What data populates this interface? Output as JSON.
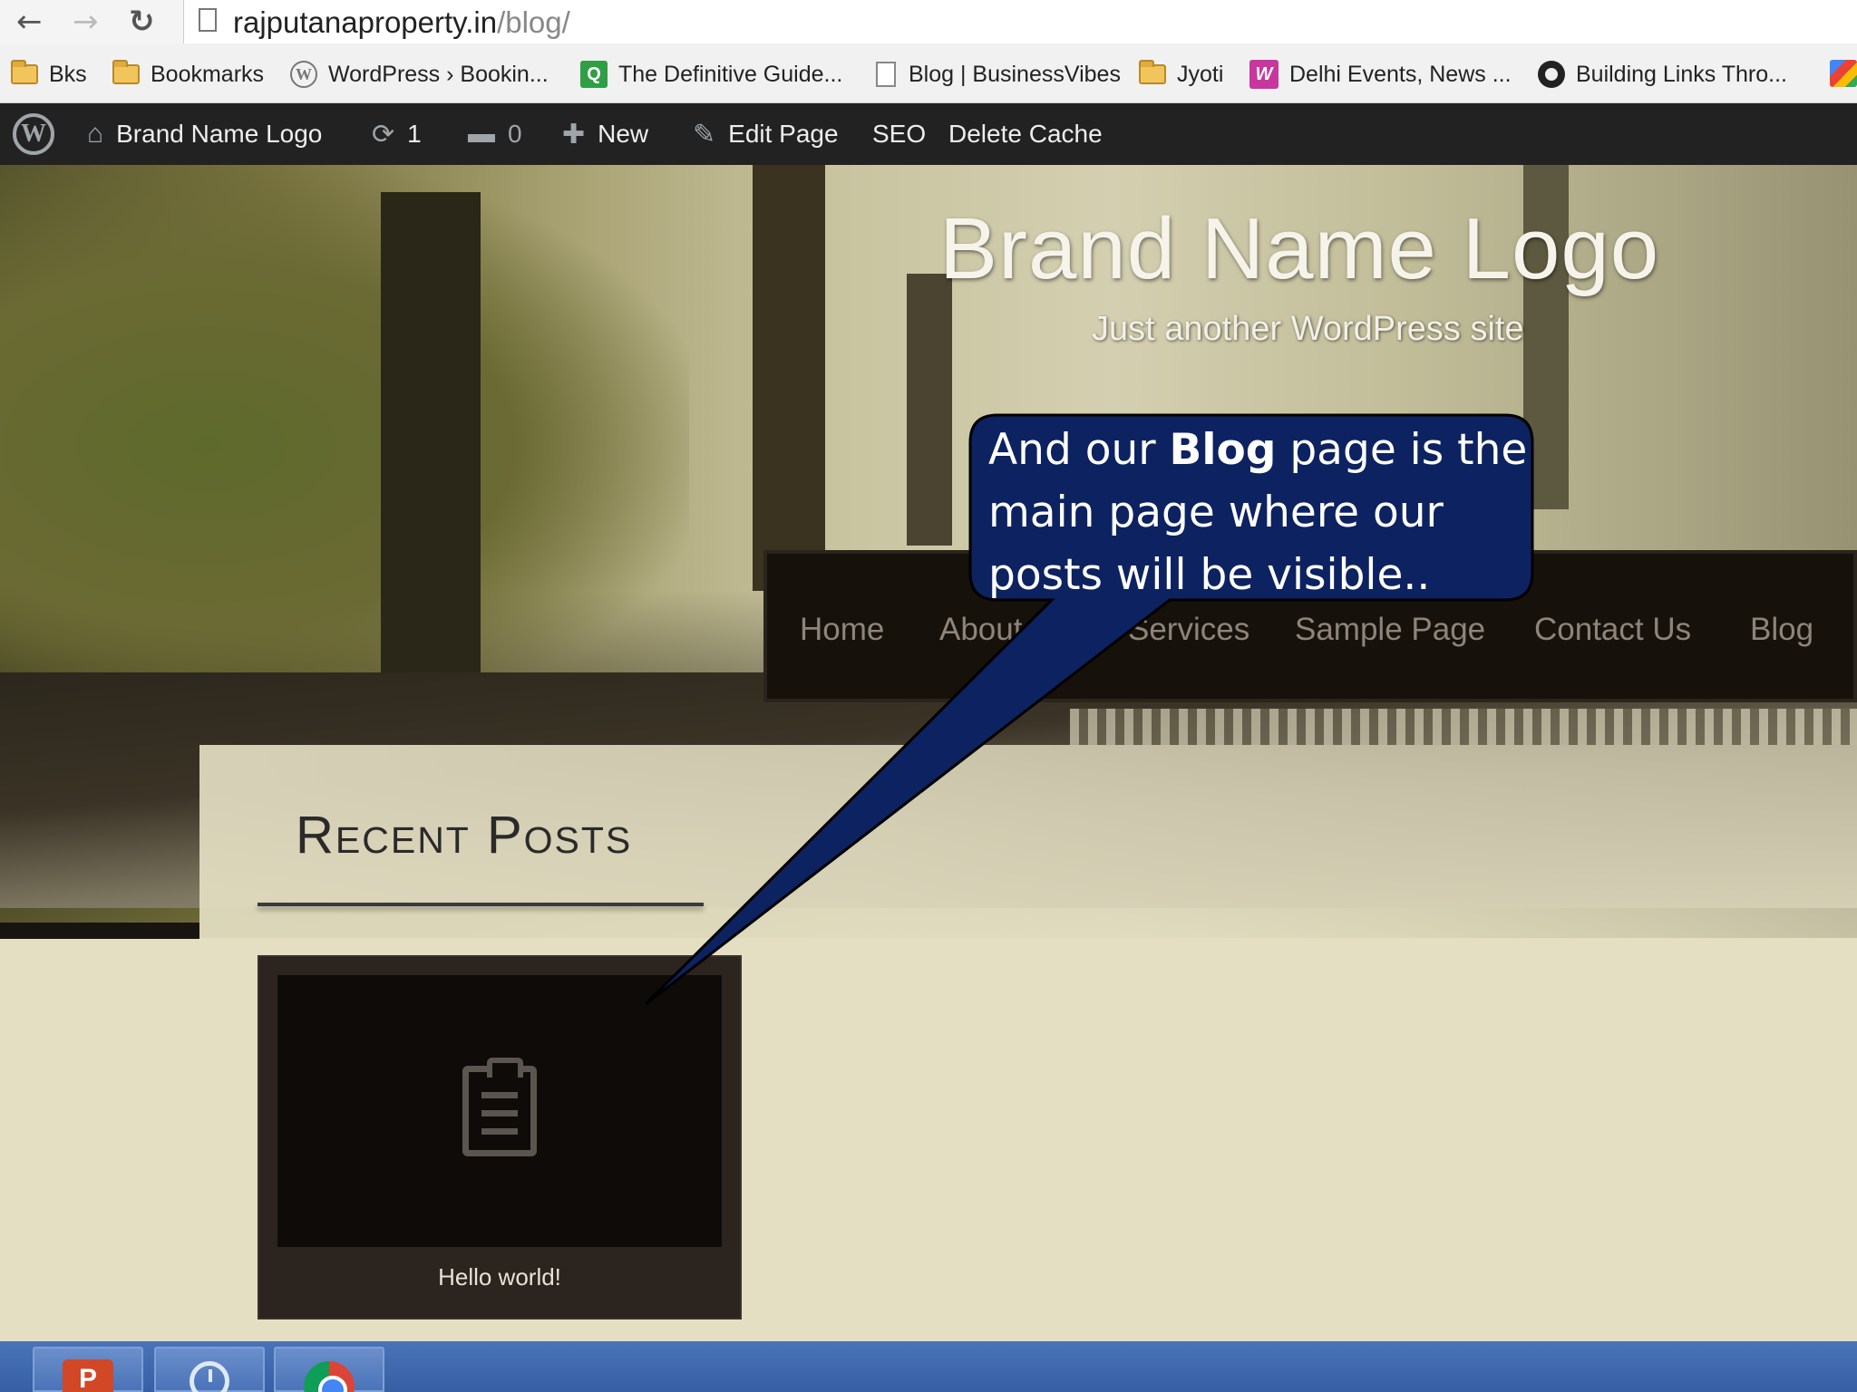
{
  "browser": {
    "url_host": "rajputanaproperty.in",
    "url_path": "/blog/",
    "bookmarks": [
      {
        "label": "Bks",
        "icon": "folder-icon"
      },
      {
        "label": "Bookmarks",
        "icon": "folder-icon"
      },
      {
        "label": "WordPress › Bookin...",
        "icon": "wordpress-icon"
      },
      {
        "label": "The Definitive Guide...",
        "icon": "green-search-icon"
      },
      {
        "label": "Blog | BusinessVibes",
        "icon": "page-icon"
      },
      {
        "label": "Jyoti",
        "icon": "folder-icon"
      },
      {
        "label": "Delhi Events, News ...",
        "icon": "w-logo-icon"
      },
      {
        "label": "Building Links Thro...",
        "icon": "swirl-icon"
      }
    ]
  },
  "admin_bar": {
    "site_name": "Brand Name Logo",
    "updates_count": "1",
    "comments_count": "0",
    "new_label": "New",
    "edit_label": "Edit Page",
    "seo_label": "SEO",
    "cache_label": "Delete Cache",
    "text_color": "#eeeeee",
    "background": "#222222"
  },
  "site": {
    "title": "Brand Name Logo",
    "tagline": "Just another WordPress site"
  },
  "nav": {
    "items": [
      "Home",
      "About Us",
      "Services",
      "Sample Page",
      "Contact Us",
      "Blog"
    ]
  },
  "content": {
    "section_heading": "Recent Posts",
    "posts": [
      {
        "title": "Hello world!",
        "icon": "clipboard-icon"
      }
    ]
  },
  "callout": {
    "text_before": "And our ",
    "text_bold": "Blog",
    "text_after": " page is the main page where our posts will be visible..",
    "fill": "#0d2260",
    "border": "#000000"
  },
  "taskbar": {
    "apps": [
      "powerpoint-icon",
      "clock-icon",
      "chrome-icon"
    ]
  }
}
